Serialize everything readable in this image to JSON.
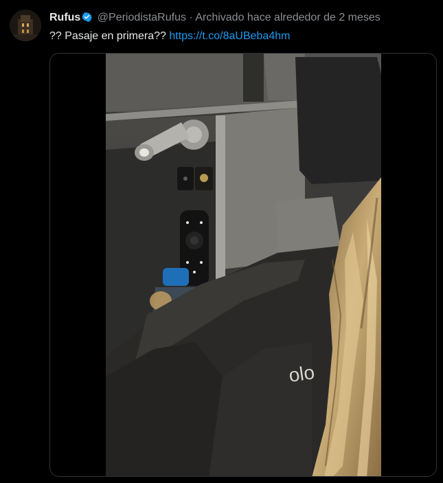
{
  "tweet": {
    "author_name": "Rufus",
    "handle": "@PeriodistaRufus",
    "separator": "·",
    "archived_label": "Archivado hace alrededor de 2 meses",
    "text": "?? Pasaje en primera??",
    "link": "https://t.co/8aUBeba4hm",
    "media_text": "olo"
  },
  "icons": {
    "avatar": "avatar-image",
    "verified": "verified-badge-icon"
  },
  "colors": {
    "background": "#000000",
    "text": "#e7e9ea",
    "muted": "#8b8f94",
    "link": "#1d9bf0",
    "verified": "#1d9bf0"
  }
}
